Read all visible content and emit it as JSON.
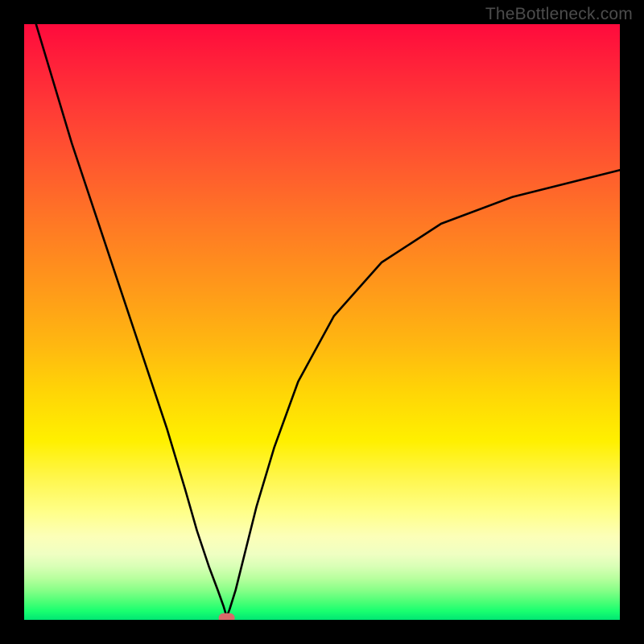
{
  "watermark": "TheBottleneck.com",
  "colors": {
    "page_background": "#000000",
    "curve_stroke": "#000000",
    "marker_fill": "#d86a6a",
    "gradient_top": "#ff0a3c",
    "gradient_mid": "#fff000",
    "gradient_bottom": "#00e673"
  },
  "chart_data": {
    "type": "line",
    "title": "",
    "xlabel": "",
    "ylabel": "",
    "xlim": [
      0,
      100
    ],
    "ylim": [
      0,
      100
    ],
    "grid": false,
    "legend": false,
    "annotations": [],
    "series": [
      {
        "name": "curve",
        "x": [
          2,
          5,
          8,
          12,
          16,
          20,
          24,
          27,
          29,
          31,
          32.5,
          33.5,
          34,
          34.5,
          35.5,
          37,
          39,
          42,
          46,
          52,
          60,
          70,
          82,
          94,
          100
        ],
        "y": [
          100,
          90,
          80,
          68,
          56,
          44,
          32,
          22,
          15,
          9,
          5,
          2.2,
          0.5,
          1.8,
          5,
          11,
          19,
          29,
          40,
          51,
          60,
          66.5,
          71,
          74,
          75.5
        ]
      }
    ],
    "marker": {
      "x": 34,
      "y": 0.3,
      "shape": "rounded-rect"
    },
    "background_gradient": {
      "direction": "vertical",
      "stops": [
        {
          "pos": 0.0,
          "color": "#ff0a3c"
        },
        {
          "pos": 0.24,
          "color": "#ff5a2e"
        },
        {
          "pos": 0.54,
          "color": "#ffb810"
        },
        {
          "pos": 0.7,
          "color": "#fff000"
        },
        {
          "pos": 0.86,
          "color": "#fcffb8"
        },
        {
          "pos": 0.95,
          "color": "#88ff88"
        },
        {
          "pos": 1.0,
          "color": "#00e673"
        }
      ]
    }
  }
}
